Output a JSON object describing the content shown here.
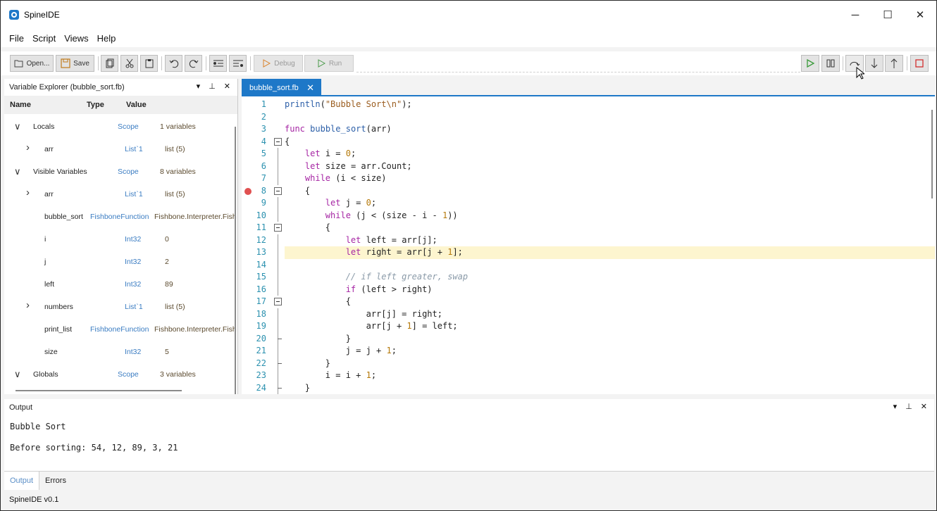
{
  "app": {
    "title": "SpineIDE",
    "version_label": "SpineIDE v0.1",
    "accent": "#1e78c8"
  },
  "window_controls": {
    "minimize": "─",
    "maximize": "☐",
    "close": "✕"
  },
  "menu": [
    "File",
    "Script",
    "Views",
    "Help"
  ],
  "toolbar": {
    "open_label": "Open...",
    "save_label": "Save",
    "debug_label": "Debug",
    "run_label": "Run"
  },
  "variable_explorer": {
    "title": "Variable Explorer (bubble_sort.fb)",
    "columns": {
      "name": "Name",
      "type": "Type",
      "value": "Value"
    },
    "rows": [
      {
        "expander": "expanded",
        "name": "Locals",
        "type": "Scope",
        "value": "1 variables"
      },
      {
        "expander": "collapsed",
        "name": "arr",
        "type": "List`1",
        "value": "list (5)"
      },
      {
        "expander": "expanded",
        "name": "Visible Variables",
        "type": "Scope",
        "value": "8 variables"
      },
      {
        "expander": "collapsed",
        "name": "arr",
        "type": "List`1",
        "value": "list (5)"
      },
      {
        "expander": "",
        "name": "bubble_sort",
        "type": "FishboneFunction",
        "value": "Fishbone.Interpreter.Fish"
      },
      {
        "expander": "",
        "name": "i",
        "type": "Int32",
        "value": "0"
      },
      {
        "expander": "",
        "name": "j",
        "type": "Int32",
        "value": "2"
      },
      {
        "expander": "",
        "name": "left",
        "type": "Int32",
        "value": "89"
      },
      {
        "expander": "collapsed",
        "name": "numbers",
        "type": "List`1",
        "value": "list (5)"
      },
      {
        "expander": "",
        "name": "print_list",
        "type": "FishboneFunction",
        "value": "Fishbone.Interpreter.Fish"
      },
      {
        "expander": "",
        "name": "size",
        "type": "Int32",
        "value": "5"
      },
      {
        "expander": "expanded",
        "name": "Globals",
        "type": "Scope",
        "value": "3 variables"
      }
    ]
  },
  "editor": {
    "tab_label": "bubble_sort.fb",
    "tab_close": "✕",
    "current_line": 13,
    "breakpoint_line": 8,
    "lines": [
      "println(\"Bubble Sort\\n\");",
      "",
      "func bubble_sort(arr)",
      "{",
      "    let i = 0;",
      "    let size = arr.Count;",
      "    while (i < size)",
      "    {",
      "        let j = 0;",
      "        while (j < (size - i - 1))",
      "        {",
      "            let left = arr[j];",
      "            let right = arr[j + 1];",
      "",
      "            // if left greater, swap",
      "            if (left > right)",
      "            {",
      "                arr[j] = right;",
      "                arr[j + 1] = left;",
      "            }",
      "            j = j + 1;",
      "        }",
      "        i = i + 1;",
      "    }"
    ]
  },
  "output": {
    "title": "Output",
    "lines": [
      "Bubble Sort",
      "Before sorting: 54, 12, 89, 3, 21"
    ]
  },
  "bottom_tabs": [
    "Output",
    "Errors"
  ],
  "panel_controls": {
    "dropdown": "▾",
    "pin": "⊥",
    "close": "✕"
  }
}
